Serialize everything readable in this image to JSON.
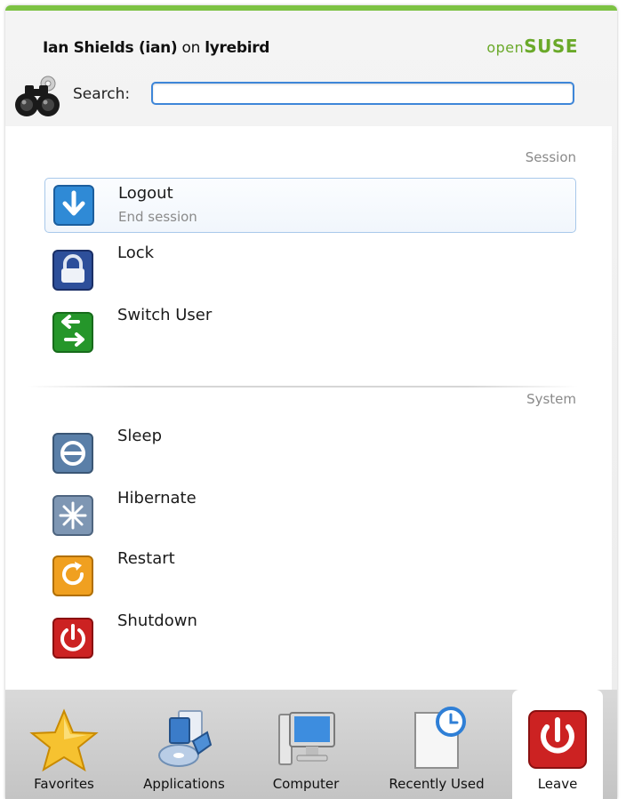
{
  "header": {
    "user_name": "Ian Shields (ian)",
    "on_text": "on",
    "host": "lyrebird",
    "brand_prefix": "open",
    "brand_name": "SUSE",
    "search_label": "Search:",
    "search_value": ""
  },
  "sections": {
    "session_title": "Session",
    "system_title": "System"
  },
  "session_items": [
    {
      "name": "Logout",
      "desc": "End session",
      "icon": "logout-icon",
      "selected": true
    },
    {
      "name": "Lock",
      "icon": "lock-icon"
    },
    {
      "name": "Switch User",
      "icon": "switch-user-icon"
    }
  ],
  "system_items": [
    {
      "name": "Sleep",
      "icon": "sleep-icon"
    },
    {
      "name": "Hibernate",
      "icon": "hibernate-icon"
    },
    {
      "name": "Restart",
      "icon": "restart-icon"
    },
    {
      "name": "Shutdown",
      "icon": "shutdown-icon"
    }
  ],
  "tabs": [
    {
      "label": "Favorites",
      "icon": "star-icon"
    },
    {
      "label": "Applications",
      "icon": "applications-icon"
    },
    {
      "label": "Computer",
      "icon": "computer-icon"
    },
    {
      "label": "Recently Used",
      "icon": "recently-used-icon"
    },
    {
      "label": "Leave",
      "icon": "leave-icon",
      "active": true
    }
  ],
  "colors": {
    "accent_green": "#7cc243",
    "search_border": "#3e86d8",
    "logout_blue": "#2f8ad6",
    "lock_blue": "#2d4f9a",
    "switch_green": "#25962a",
    "restart_orange": "#f0a020",
    "shutdown_red": "#cc2222"
  }
}
